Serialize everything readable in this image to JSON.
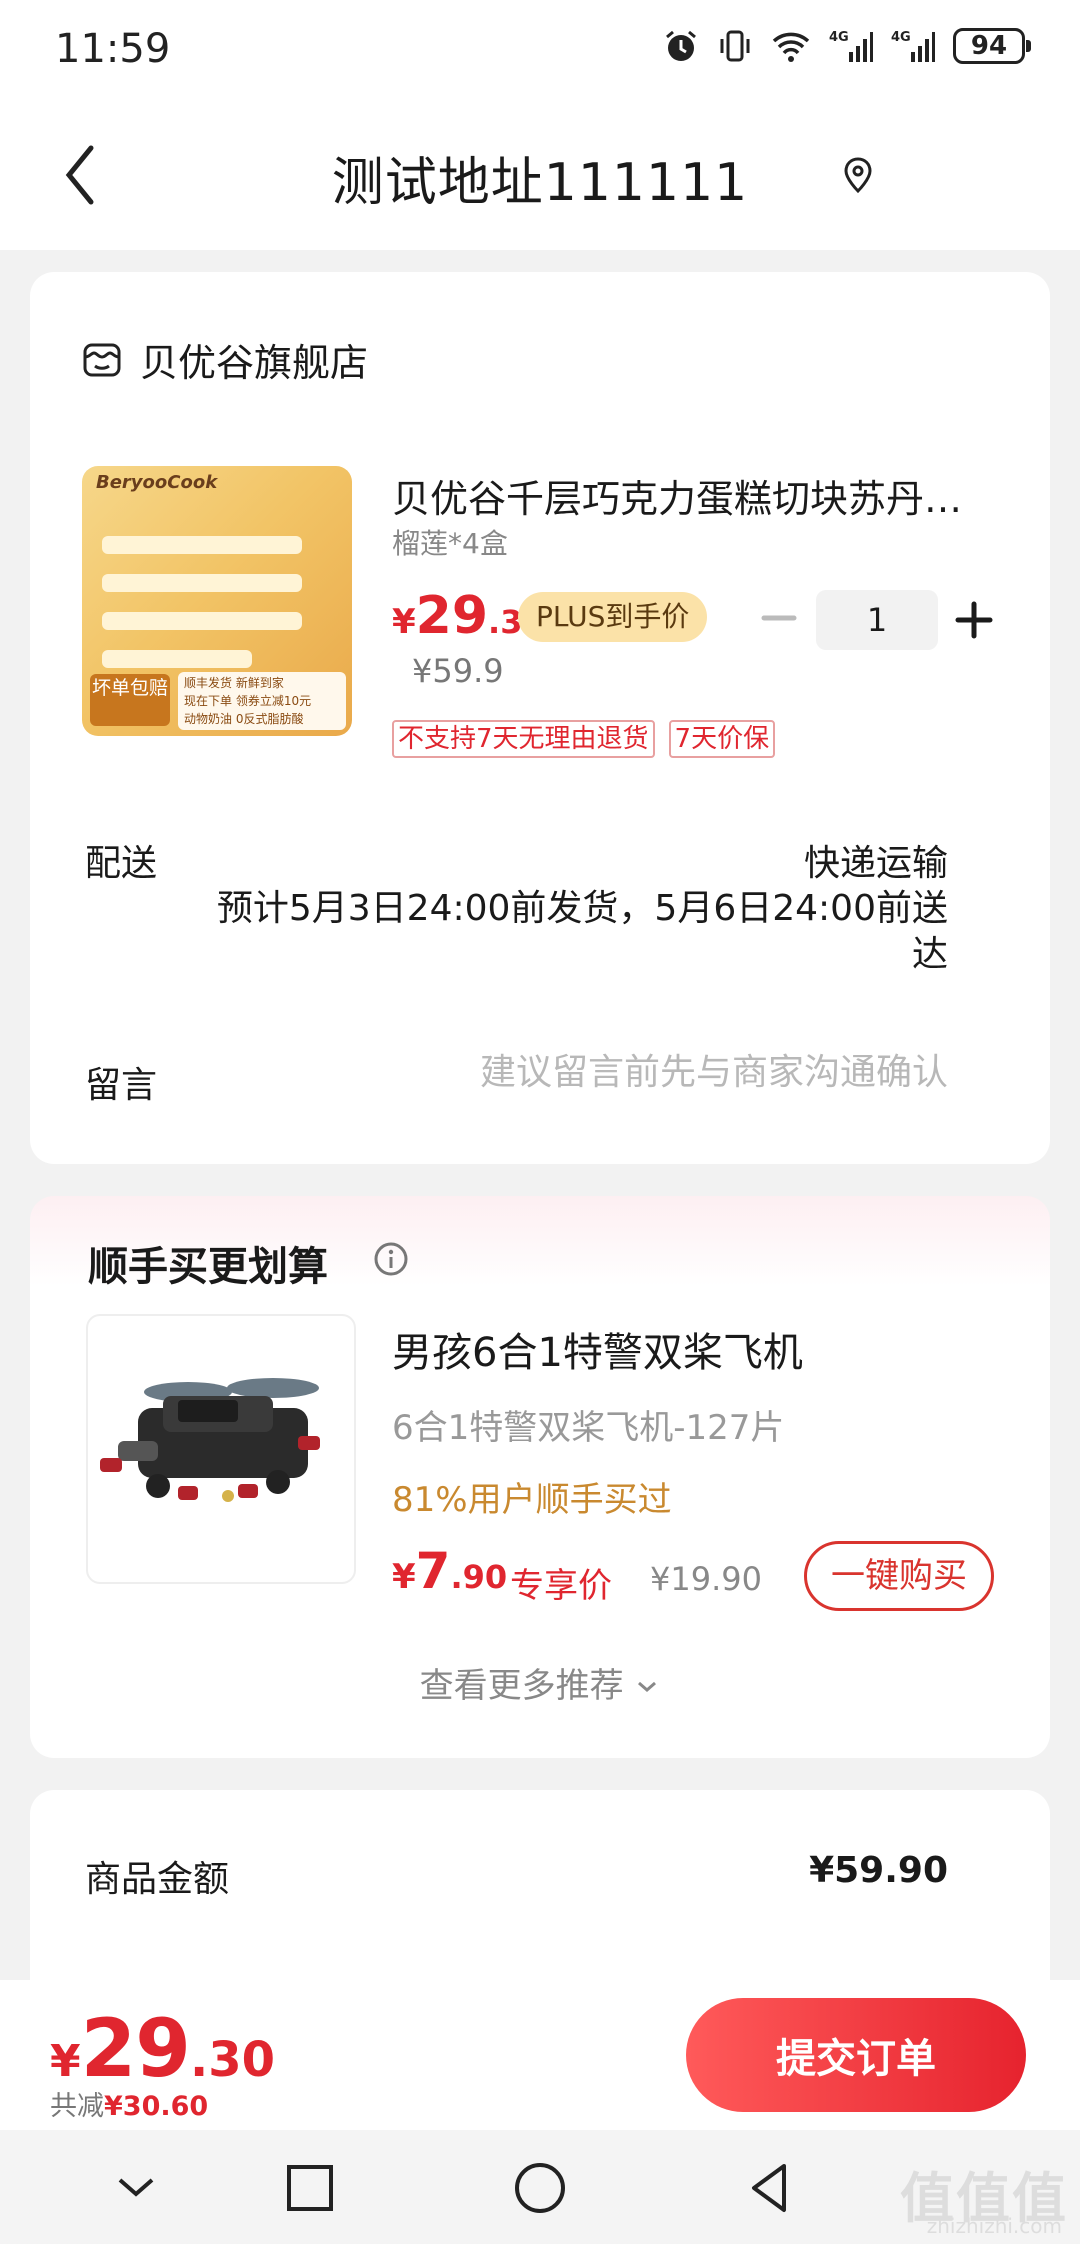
{
  "status": {
    "time": "11:59",
    "battery": "94",
    "net1": "4G",
    "net2": "4G"
  },
  "header": {
    "title": "测试地址111111"
  },
  "shop": {
    "name": "贝优谷旗舰店",
    "product": {
      "title": "贝优谷千层巧克力蛋糕切块苏丹王榴莲",
      "spec": "榴莲*4盒",
      "price_yen": "¥",
      "price_int": "29",
      "price_dec": ".3",
      "plus_label": "PLUS到手价",
      "old_price": "¥59.9",
      "qty": "1",
      "tags": [
        "不支持7天无理由退货",
        "7天价保"
      ],
      "image": {
        "brand": "BeryooCook",
        "tag": "坏单包赔",
        "promo_line1": "顺丰发货 新鲜到家",
        "promo_line2": "现在下单 领券立减10元",
        "promo_line3": "动物奶油 0反式脂肪酸"
      }
    },
    "delivery": {
      "label": "配送",
      "method": "快递运输",
      "estimate": "预计5月3日24:00前发货，5月6日24:00前送达"
    },
    "message": {
      "label": "留言",
      "placeholder": "建议留言前先与商家沟通确认"
    }
  },
  "recommend": {
    "title": "顺手买更划算",
    "item": {
      "title": "男孩6合1特警双桨飞机",
      "spec": "6合1特警双桨飞机-127片",
      "social": "81%用户顺手买过",
      "price_yen": "¥",
      "price_int": "7",
      "price_dec": ".90",
      "exclusive": "专享价",
      "old_price": "¥19.90",
      "buy_label": "一键购买"
    },
    "more": "查看更多推荐"
  },
  "summary": {
    "label": "商品金额",
    "value": "¥59.90"
  },
  "footer": {
    "total_yen": "¥",
    "total_int": "29",
    "total_dec": ".30",
    "saved_prefix": "共减",
    "saved_value": "¥30.60",
    "submit": "提交订单"
  },
  "watermark": {
    "text": "值值值",
    "sub": "zhizhizhi.com"
  },
  "colors": {
    "accent": "#e0262f",
    "plus_badge": "#fbe2a8",
    "social": "#c9892f"
  }
}
